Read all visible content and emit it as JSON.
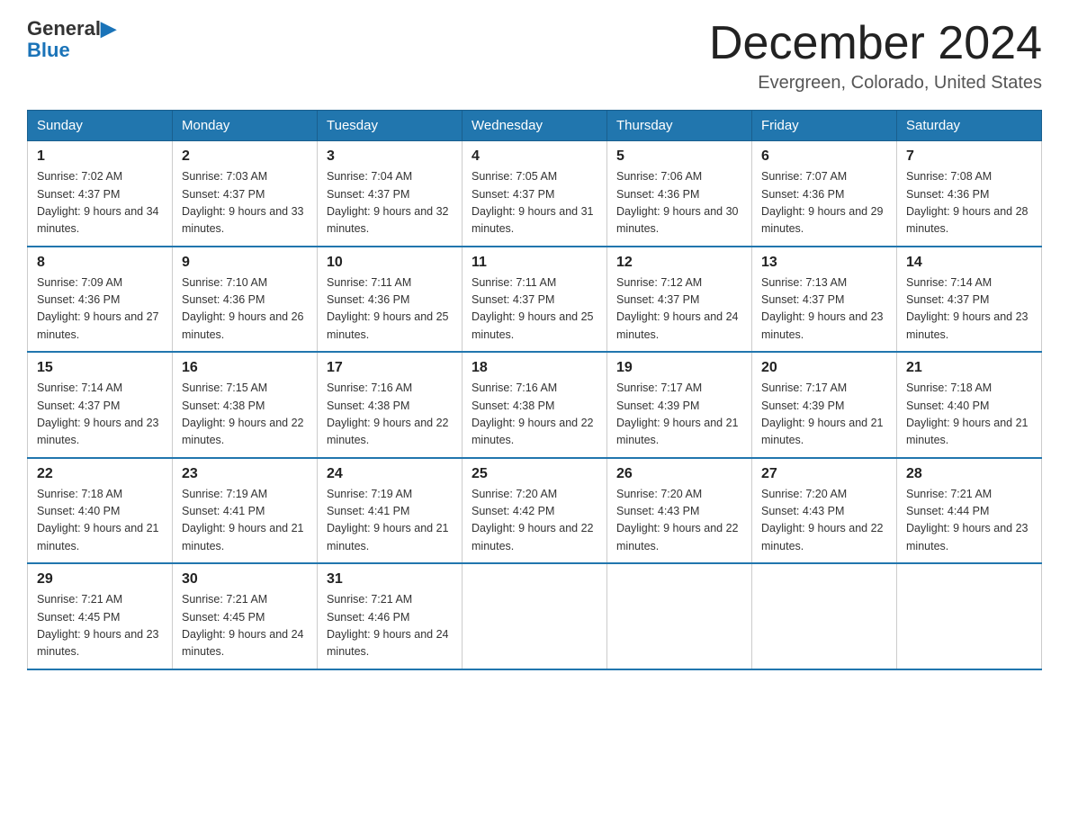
{
  "header": {
    "logo_line1": "General",
    "logo_line2": "Blue",
    "title": "December 2024",
    "subtitle": "Evergreen, Colorado, United States"
  },
  "days_of_week": [
    "Sunday",
    "Monday",
    "Tuesday",
    "Wednesday",
    "Thursday",
    "Friday",
    "Saturday"
  ],
  "weeks": [
    [
      {
        "day": "1",
        "sunrise": "7:02 AM",
        "sunset": "4:37 PM",
        "daylight": "9 hours and 34 minutes."
      },
      {
        "day": "2",
        "sunrise": "7:03 AM",
        "sunset": "4:37 PM",
        "daylight": "9 hours and 33 minutes."
      },
      {
        "day": "3",
        "sunrise": "7:04 AM",
        "sunset": "4:37 PM",
        "daylight": "9 hours and 32 minutes."
      },
      {
        "day": "4",
        "sunrise": "7:05 AM",
        "sunset": "4:37 PM",
        "daylight": "9 hours and 31 minutes."
      },
      {
        "day": "5",
        "sunrise": "7:06 AM",
        "sunset": "4:36 PM",
        "daylight": "9 hours and 30 minutes."
      },
      {
        "day": "6",
        "sunrise": "7:07 AM",
        "sunset": "4:36 PM",
        "daylight": "9 hours and 29 minutes."
      },
      {
        "day": "7",
        "sunrise": "7:08 AM",
        "sunset": "4:36 PM",
        "daylight": "9 hours and 28 minutes."
      }
    ],
    [
      {
        "day": "8",
        "sunrise": "7:09 AM",
        "sunset": "4:36 PM",
        "daylight": "9 hours and 27 minutes."
      },
      {
        "day": "9",
        "sunrise": "7:10 AM",
        "sunset": "4:36 PM",
        "daylight": "9 hours and 26 minutes."
      },
      {
        "day": "10",
        "sunrise": "7:11 AM",
        "sunset": "4:36 PM",
        "daylight": "9 hours and 25 minutes."
      },
      {
        "day": "11",
        "sunrise": "7:11 AM",
        "sunset": "4:37 PM",
        "daylight": "9 hours and 25 minutes."
      },
      {
        "day": "12",
        "sunrise": "7:12 AM",
        "sunset": "4:37 PM",
        "daylight": "9 hours and 24 minutes."
      },
      {
        "day": "13",
        "sunrise": "7:13 AM",
        "sunset": "4:37 PM",
        "daylight": "9 hours and 23 minutes."
      },
      {
        "day": "14",
        "sunrise": "7:14 AM",
        "sunset": "4:37 PM",
        "daylight": "9 hours and 23 minutes."
      }
    ],
    [
      {
        "day": "15",
        "sunrise": "7:14 AM",
        "sunset": "4:37 PM",
        "daylight": "9 hours and 23 minutes."
      },
      {
        "day": "16",
        "sunrise": "7:15 AM",
        "sunset": "4:38 PM",
        "daylight": "9 hours and 22 minutes."
      },
      {
        "day": "17",
        "sunrise": "7:16 AM",
        "sunset": "4:38 PM",
        "daylight": "9 hours and 22 minutes."
      },
      {
        "day": "18",
        "sunrise": "7:16 AM",
        "sunset": "4:38 PM",
        "daylight": "9 hours and 22 minutes."
      },
      {
        "day": "19",
        "sunrise": "7:17 AM",
        "sunset": "4:39 PM",
        "daylight": "9 hours and 21 minutes."
      },
      {
        "day": "20",
        "sunrise": "7:17 AM",
        "sunset": "4:39 PM",
        "daylight": "9 hours and 21 minutes."
      },
      {
        "day": "21",
        "sunrise": "7:18 AM",
        "sunset": "4:40 PM",
        "daylight": "9 hours and 21 minutes."
      }
    ],
    [
      {
        "day": "22",
        "sunrise": "7:18 AM",
        "sunset": "4:40 PM",
        "daylight": "9 hours and 21 minutes."
      },
      {
        "day": "23",
        "sunrise": "7:19 AM",
        "sunset": "4:41 PM",
        "daylight": "9 hours and 21 minutes."
      },
      {
        "day": "24",
        "sunrise": "7:19 AM",
        "sunset": "4:41 PM",
        "daylight": "9 hours and 21 minutes."
      },
      {
        "day": "25",
        "sunrise": "7:20 AM",
        "sunset": "4:42 PM",
        "daylight": "9 hours and 22 minutes."
      },
      {
        "day": "26",
        "sunrise": "7:20 AM",
        "sunset": "4:43 PM",
        "daylight": "9 hours and 22 minutes."
      },
      {
        "day": "27",
        "sunrise": "7:20 AM",
        "sunset": "4:43 PM",
        "daylight": "9 hours and 22 minutes."
      },
      {
        "day": "28",
        "sunrise": "7:21 AM",
        "sunset": "4:44 PM",
        "daylight": "9 hours and 23 minutes."
      }
    ],
    [
      {
        "day": "29",
        "sunrise": "7:21 AM",
        "sunset": "4:45 PM",
        "daylight": "9 hours and 23 minutes."
      },
      {
        "day": "30",
        "sunrise": "7:21 AM",
        "sunset": "4:45 PM",
        "daylight": "9 hours and 24 minutes."
      },
      {
        "day": "31",
        "sunrise": "7:21 AM",
        "sunset": "4:46 PM",
        "daylight": "9 hours and 24 minutes."
      },
      null,
      null,
      null,
      null
    ]
  ]
}
